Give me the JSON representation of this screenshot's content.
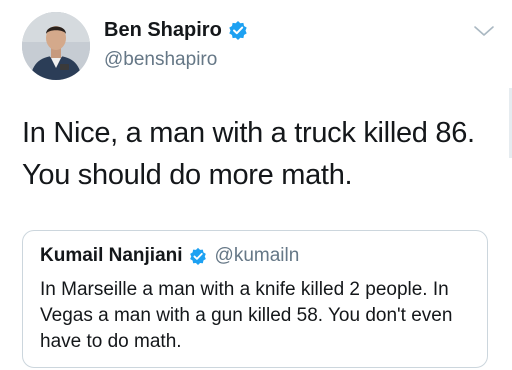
{
  "author": {
    "display_name": "Ben Shapiro",
    "handle": "@benshapiro",
    "verified": true
  },
  "tweet_text": "In Nice, a man with a truck killed 86. You should do more math.",
  "quoted_tweet": {
    "display_name": "Kumail Nanjiani",
    "handle": "@kumailn",
    "verified": true,
    "text": "In Marseille a man with a knife killed 2 people. In Vegas a man with a gun killed 58. You don't even have to do math."
  },
  "icons": {
    "verified": "verified-badge-icon",
    "menu": "chevron-down-icon"
  },
  "colors": {
    "verified_blue": "#1da1f2",
    "secondary_text": "#657786",
    "border": "#ccd6dd"
  }
}
